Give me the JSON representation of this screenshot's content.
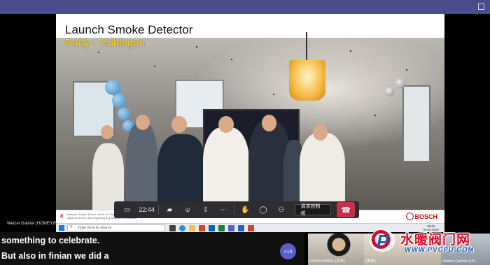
{
  "slide": {
    "title": "Launch Smoke Detector",
    "subtitle": "Party - Vaihingen",
    "page_number": "8",
    "footer_legal": "Internal | Robert Bosch GmbH | © Robert Bosch GmbH 2022. All rights reserved, also regarding any disposal, exploitation, reproduction, editing, distribution, as well as in the event of applications for industrial property rights.",
    "brand": "BOSCH"
  },
  "presenter": {
    "name": "Wetzel Gabriel (HOME/GR"
  },
  "call_controls": {
    "timer": "22:44",
    "request_control_label": "请求控制权",
    "icons": [
      "camera-icon",
      "mic-icon",
      "share-icon",
      "more-icon",
      "raise-hand-icon",
      "chat-icon",
      "participants-icon",
      "hangup-icon"
    ]
  },
  "taskbar": {
    "search_placeholder": "Type here to search",
    "time": "06:05",
    "date": "06.05.2022"
  },
  "captions": [
    "something to celebrate.",
    "But also in finian we did a"
  ],
  "participants": {
    "more_count": "+15",
    "tiles": [
      {
        "name": "KAIXN WANG (发布)"
      },
      {
        "name": "(发布)"
      },
      {
        "name": "Wetzel Gabriel (HO"
      }
    ]
  },
  "watermark": {
    "text": "水暖阀门网",
    "url": "WWW.PVCPU.COM"
  },
  "colors": {
    "title_bar": "#4b4c8c",
    "subtitle_yellow": "#f5d400",
    "hangup_red": "#c4314b",
    "bosch_red": "#d10a11",
    "more_badge": "#5b5fc7"
  }
}
